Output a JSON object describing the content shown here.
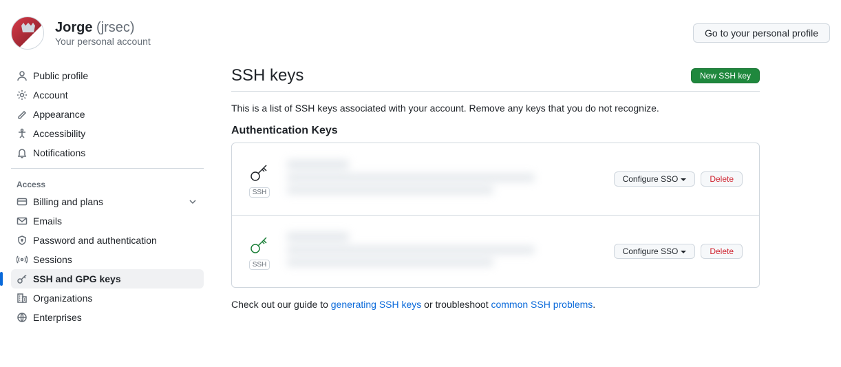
{
  "header": {
    "display_name": "Jorge",
    "username": "(jrsec)",
    "subtitle": "Your personal account",
    "profile_btn": "Go to your personal profile"
  },
  "sidebar": {
    "items_top": [
      {
        "label": "Public profile",
        "icon": "person"
      },
      {
        "label": "Account",
        "icon": "gear"
      },
      {
        "label": "Appearance",
        "icon": "brush"
      },
      {
        "label": "Accessibility",
        "icon": "accessibility"
      },
      {
        "label": "Notifications",
        "icon": "bell"
      }
    ],
    "access_heading": "Access",
    "items_access": [
      {
        "label": "Billing and plans",
        "icon": "card",
        "chevron": true
      },
      {
        "label": "Emails",
        "icon": "mail"
      },
      {
        "label": "Password and authentication",
        "icon": "shield"
      },
      {
        "label": "Sessions",
        "icon": "broadcast"
      },
      {
        "label": "SSH and GPG keys",
        "icon": "key",
        "active": true
      },
      {
        "label": "Organizations",
        "icon": "org"
      },
      {
        "label": "Enterprises",
        "icon": "globe"
      }
    ]
  },
  "page": {
    "title": "SSH keys",
    "new_btn": "New SSH key",
    "description": "This is a list of SSH keys associated with your account. Remove any keys that you do not recognize.",
    "auth_heading": "Authentication Keys",
    "configure_sso": "Configure SSO",
    "delete": "Delete",
    "ssh_badge": "SSH",
    "footer_pre": "Check out our guide to ",
    "footer_link1": "generating SSH keys",
    "footer_mid": " or troubleshoot ",
    "footer_link2": "common SSH problems",
    "footer_post": "."
  },
  "keys": [
    {
      "status": "dark"
    },
    {
      "status": "green"
    }
  ]
}
